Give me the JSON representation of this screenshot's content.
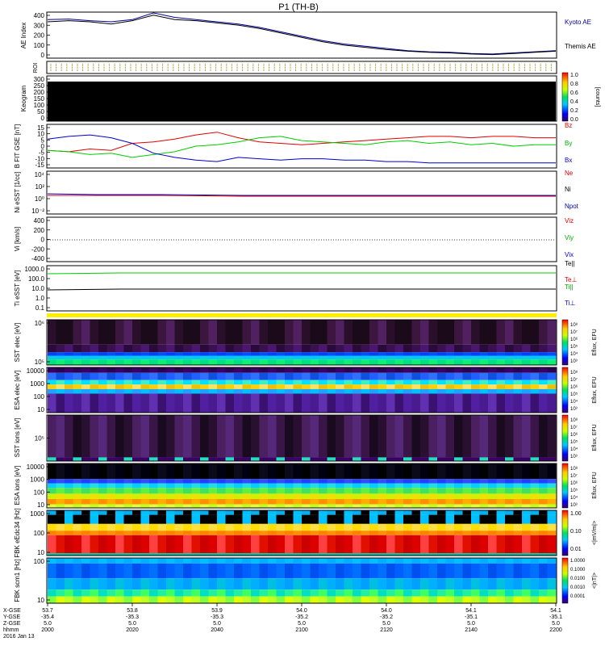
{
  "title": "P1 (TH-B)",
  "colors": {
    "bx": "#0000cc",
    "by": "#00cc00",
    "bz": "#dd0000",
    "kyoto": "#000099",
    "themis": "#000000"
  },
  "panels": {
    "ae": {
      "label": "AE Index",
      "ticks": [
        "400",
        "300",
        "200",
        "100",
        "0"
      ],
      "legend": [
        "Kyoto AE",
        "Themis AE"
      ]
    },
    "roi": {
      "label": "ROI"
    },
    "keogram": {
      "label": "Keogram",
      "ticks": [
        "300",
        "250",
        "200",
        "150",
        "100",
        "50",
        "0"
      ],
      "cbar_label": "[counts]",
      "cbar_ticks": [
        "1.0",
        "0.8",
        "0.6",
        "0.4",
        "0.2",
        "0.0"
      ]
    },
    "bfgm": {
      "label": "B FIT GSE [nT]",
      "ticks": [
        "15",
        "10",
        "5",
        "0",
        "-5",
        "-10",
        "-15"
      ],
      "legend": [
        "Bz",
        "By",
        "Bx"
      ]
    },
    "ni": {
      "label": "Ni eSST [1/cc]",
      "ticks": [
        "10⁴",
        "10²",
        "10⁰",
        "10⁻²"
      ],
      "legend": [
        "Ne",
        "Ni",
        "Npot"
      ]
    },
    "vi": {
      "label": "Vi [km/s]",
      "ticks": [
        "400",
        "200",
        "0",
        "-200",
        "-400"
      ],
      "legend": [
        "Viz",
        "Viy",
        "Vix"
      ]
    },
    "ti": {
      "label": "Ti eSST [eV]",
      "ticks": [
        "1000.0",
        "100.0",
        "10.0",
        "1.0",
        "0.1"
      ],
      "legend": [
        "Te||",
        "Te⊥",
        "Ti||",
        "Ti⊥"
      ]
    },
    "sst_e": {
      "label": "SST elec [eV]",
      "ticks": [
        "10⁶",
        "10⁵"
      ],
      "cbar_label": "Eflux, EFU"
    },
    "esa_e": {
      "label": "ESA elec [eV]",
      "ticks": [
        "10000",
        "1000",
        "100",
        "10"
      ],
      "cbar_label": "Eflux, EFU"
    },
    "sst_i": {
      "label": "SST ions [eV]",
      "ticks": [
        "10⁵"
      ],
      "cbar_label": "Eflux, EFU"
    },
    "esa_i": {
      "label": "ESA ions [eV]",
      "ticks": [
        "10000",
        "1000",
        "100",
        "10"
      ],
      "cbar_label": "Eflux, EFU"
    },
    "fbk_e": {
      "label": "FBK eEdc34 [Hz]",
      "ticks": [
        "1000",
        "100",
        "10"
      ],
      "cbar_label": "<|mV/m|>",
      "cbar_ticks": [
        "1.00",
        "0.10",
        "0.01"
      ]
    },
    "fbk_b": {
      "label": "FBK scm1 [Hz]",
      "ticks": [
        "100",
        "10"
      ],
      "cbar_label": "<|nT|>",
      "cbar_ticks": [
        "1.0000",
        "0.1000",
        "0.0100",
        "0.0010",
        "0.0001"
      ]
    },
    "eflux_ticks": [
      "10⁸",
      "10⁷",
      "10⁶",
      "10⁵",
      "10⁴",
      "10³"
    ]
  },
  "x_axis": {
    "row_labels": [
      "X-GSE",
      "Y-GSE",
      "Z-GSE",
      "hhmm",
      "2016 Jan 13"
    ],
    "columns": [
      {
        "x": "53.7",
        "y": "-35.4",
        "z": "5.0",
        "t": "2000"
      },
      {
        "x": "53.8",
        "y": "-35.3",
        "z": "5.0",
        "t": "2020"
      },
      {
        "x": "53.9",
        "y": "-35.3",
        "z": "5.0",
        "t": "2040"
      },
      {
        "x": "54.0",
        "y": "-35.2",
        "z": "5.0",
        "t": "2100"
      },
      {
        "x": "54.0",
        "y": "-35.2",
        "z": "5.0",
        "t": "2120"
      },
      {
        "x": "54.1",
        "y": "-35.1",
        "z": "5.0",
        "t": "2140"
      },
      {
        "x": "54.1",
        "y": "-35.1",
        "z": "5.0",
        "t": "2200"
      }
    ]
  },
  "chart_data": [
    {
      "type": "line",
      "title": "AE Index",
      "x": [
        2000,
        2005,
        2010,
        2015,
        2020,
        2025,
        2030,
        2035,
        2040,
        2045,
        2050,
        2055,
        2100,
        2105,
        2110,
        2115,
        2120,
        2125,
        2130,
        2135,
        2140,
        2145,
        2150,
        2155,
        2200
      ],
      "series": [
        {
          "name": "Kyoto AE",
          "values": [
            340,
            345,
            330,
            320,
            340,
            400,
            360,
            340,
            320,
            300,
            270,
            230,
            190,
            150,
            120,
            100,
            80,
            60,
            50,
            45,
            35,
            30,
            40,
            50,
            60
          ]
        },
        {
          "name": "Themis AE",
          "values": [
            320,
            330,
            320,
            300,
            330,
            380,
            340,
            330,
            310,
            290,
            260,
            220,
            180,
            140,
            110,
            90,
            70,
            55,
            45,
            40,
            30,
            25,
            35,
            45,
            55
          ]
        }
      ],
      "ylim": [
        0,
        400
      ]
    },
    {
      "type": "line",
      "title": "B FIT GSE",
      "x": [
        2000,
        2005,
        2010,
        2015,
        2020,
        2025,
        2030,
        2035,
        2040,
        2045,
        2050,
        2055,
        2100,
        2105,
        2110,
        2115,
        2120,
        2125,
        2130,
        2135,
        2140,
        2145,
        2150,
        2155,
        2200
      ],
      "series": [
        {
          "name": "Bz",
          "values": [
            -3,
            -4,
            -2,
            -3,
            2,
            3,
            5,
            8,
            10,
            6,
            3,
            2,
            1,
            2,
            3,
            4,
            5,
            6,
            7,
            7,
            6,
            7,
            7,
            6,
            6
          ]
        },
        {
          "name": "By",
          "values": [
            -3,
            -4,
            -6,
            -5,
            -8,
            -6,
            -4,
            0,
            1,
            3,
            6,
            7,
            4,
            3,
            2,
            1,
            3,
            4,
            2,
            3,
            1,
            2,
            0,
            1,
            1
          ]
        },
        {
          "name": "Bx",
          "values": [
            5,
            7,
            8,
            6,
            2,
            -5,
            -8,
            -10,
            -11,
            -8,
            -9,
            -10,
            -9,
            -9,
            -10,
            -10,
            -11,
            -11,
            -12,
            -12,
            -12,
            -12,
            -12,
            -12,
            -12
          ]
        }
      ],
      "ylim": [
        -15,
        15
      ]
    },
    {
      "type": "line",
      "title": "Vi",
      "x": [
        2000,
        2200
      ],
      "series": [
        {
          "name": "Viz",
          "values": [
            0,
            0
          ]
        }
      ],
      "ylim": [
        -400,
        400
      ]
    }
  ]
}
